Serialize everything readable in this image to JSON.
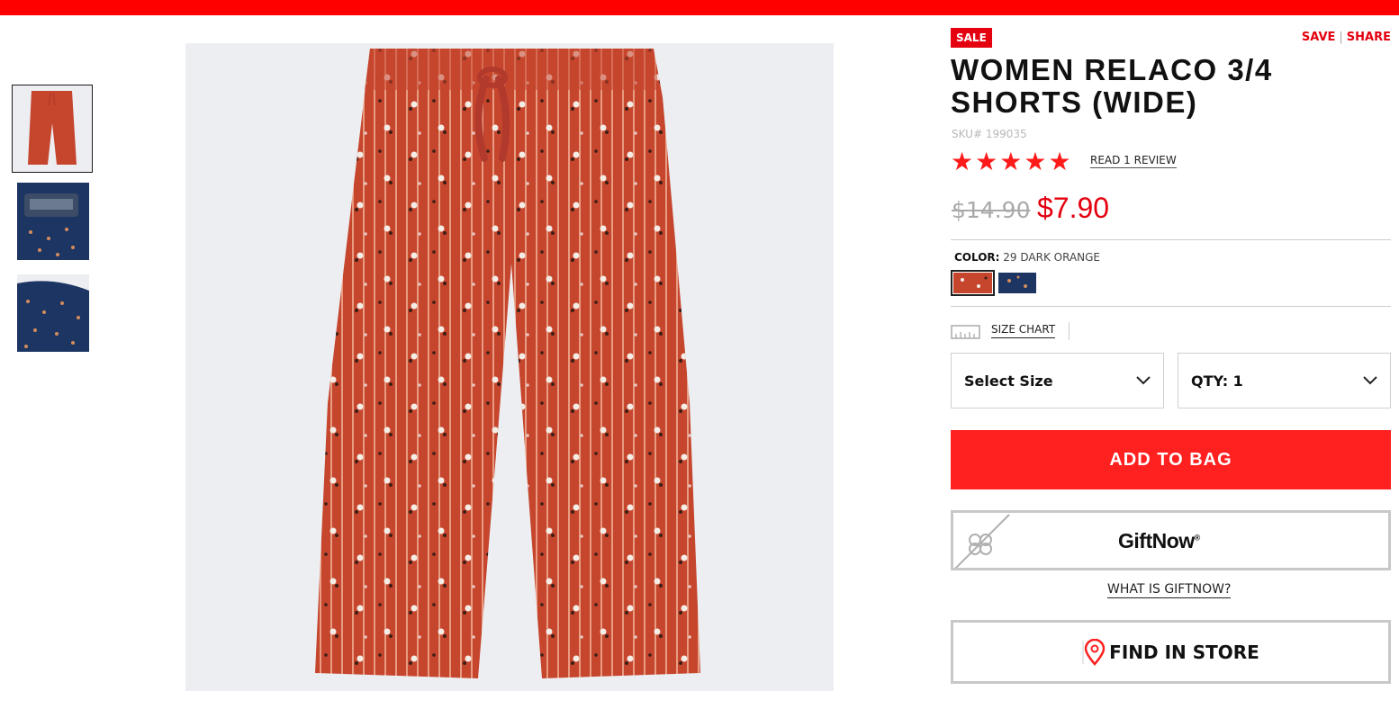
{
  "badge": {
    "sale": "SALE"
  },
  "actions": {
    "save": "SAVE",
    "separator": "|",
    "share": "SHARE"
  },
  "product": {
    "title": "WOMEN RELACO 3/4 SHORTS (WIDE)",
    "sku": "SKU# 199035",
    "rating": 5,
    "max_rating": 5,
    "review_link": "READ 1 REVIEW",
    "original_price": "$14.90",
    "sale_price": "$7.90"
  },
  "color": {
    "label": "COLOR:",
    "selected_value": "29 DARK ORANGE",
    "swatches": [
      {
        "name": "dark-orange",
        "color": "#c6452d",
        "selected": true
      },
      {
        "name": "navy",
        "color": "#1d3563",
        "selected": false
      }
    ]
  },
  "size_chart": {
    "label": "SIZE CHART"
  },
  "selectors": {
    "size_label": "Select Size",
    "qty_label": "QTY: 1"
  },
  "buttons": {
    "add_to_bag": "ADD TO BAG",
    "giftnow": "GiftNow",
    "giftnow_mark": "®",
    "what_is_giftnow": "WHAT IS GIFTNOW?",
    "find_in_store": "FIND IN STORE"
  },
  "icons": {
    "star": "star-icon",
    "dropdown": "chevron-down-icon",
    "ruler": "ruler-icon",
    "gift": "gift-ribbon-icon",
    "location": "map-pin-icon"
  },
  "colors": {
    "brand_red": "#ff0000",
    "sale_red": "#e4000f",
    "button_red": "#ff2020",
    "product_orange": "#c6452d",
    "product_navy": "#1d3563"
  }
}
